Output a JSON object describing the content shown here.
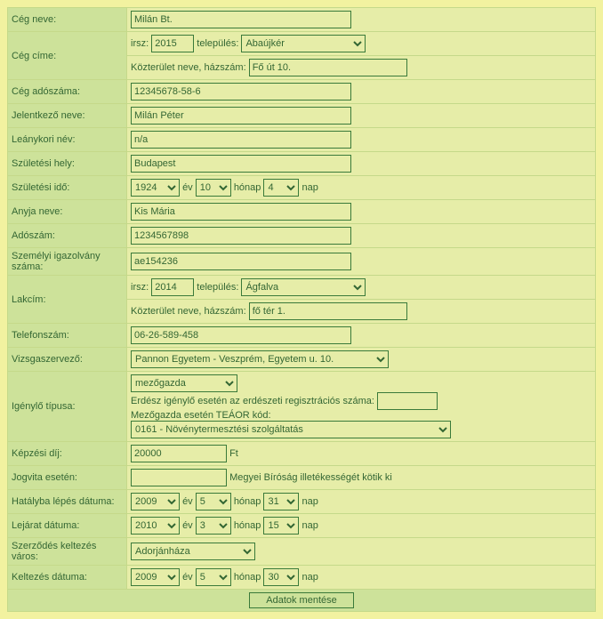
{
  "labels": {
    "ceg_neve": "Cég neve:",
    "ceg_cime": "Cég címe:",
    "irsz": "irsz:",
    "telepules": "település:",
    "kozterulet": "Közterület neve, házszám:",
    "ceg_adoszama": "Cég adószáma:",
    "jelentkezo_neve": "Jelentkező neve:",
    "leanykori_nev": "Leánykori név:",
    "szuletesi_hely": "Születési hely:",
    "szuletesi_ido": "Születési idő:",
    "ev": "év",
    "honap": "hónap",
    "nap": "nap",
    "anyja_neve": "Anyja neve:",
    "adoszam": "Adószám:",
    "szig": "Személyi igazolvány száma:",
    "lakcim": "Lakcím:",
    "telefonszam": "Telefonszám:",
    "vizsga": "Vizsgaszervező:",
    "igenylo": "Igénylő típusa:",
    "erdesz": "Erdész igénylő esetén az erdészeti regisztrációs száma:",
    "teaor": "Mezőgazda esetén TEÁOR kód:",
    "kepzesi_dij": "Képzési díj:",
    "ft": "Ft",
    "jogvita": "Jogvita esetén:",
    "jogvita_suffix": "Megyei Bíróság illetékességét kötik ki",
    "hatalyba": "Hatályba lépés dátuma:",
    "lejarat": "Lejárat dátuma:",
    "keltezes_varos": "Szerződés keltezés város:",
    "keltezes_datuma": "Keltezés dátuma:",
    "save": "Adatok mentése"
  },
  "values": {
    "ceg_neve": "Milán Bt.",
    "ceg_irsz": "2015",
    "ceg_telepules": "Abaújkér",
    "ceg_kozterulet": "Fő út 10.",
    "ceg_adoszama": "12345678-58-6",
    "jelentkezo_neve": "Milán Péter",
    "leanykori_nev": "n/a",
    "szuletesi_hely": "Budapest",
    "szul_ev": "1924",
    "szul_ho": "10",
    "szul_nap": "4",
    "anyja_neve": "Kis Mária",
    "adoszam": "1234567898",
    "szig": "ae154236",
    "lak_irsz": "2014",
    "lak_telepules": "Ágfalva",
    "lak_kozterulet": "fő tér 1.",
    "telefonszam": "06-26-589-458",
    "vizsga": "Pannon Egyetem - Veszprém, Egyetem u. 10.",
    "igenylo_tipus": "mezőgazda",
    "erdesz_reg": "",
    "teaor_kod": "0161 - Növénytermesztési szolgáltatás",
    "kepzesi_dij": "20000",
    "jogvita": "",
    "hat_ev": "2009",
    "hat_ho": "5",
    "hat_nap": "31",
    "lej_ev": "2010",
    "lej_ho": "3",
    "lej_nap": "15",
    "kelt_varos": "Adorjánháza",
    "kelt_ev": "2009",
    "kelt_ho": "5",
    "kelt_nap": "30"
  }
}
